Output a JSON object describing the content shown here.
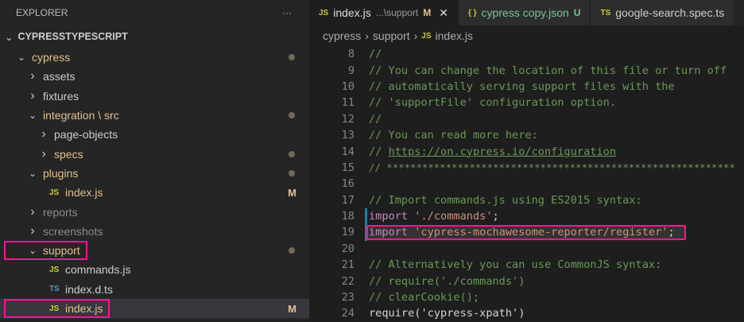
{
  "explorer": {
    "title": "EXPLORER",
    "more": "···",
    "root": "CYPRESSTYPESCRIPT",
    "items": [
      {
        "label": "cypress",
        "type": "folder",
        "open": true,
        "depth": 1,
        "dot": true
      },
      {
        "label": "assets",
        "type": "folder",
        "open": false,
        "depth": 2
      },
      {
        "label": "fixtures",
        "type": "folder",
        "open": false,
        "depth": 2
      },
      {
        "label": "integration \\ src",
        "type": "folder",
        "open": true,
        "depth": 2,
        "dot": true
      },
      {
        "label": "page-objects",
        "type": "folder",
        "open": false,
        "depth": 3
      },
      {
        "label": "specs",
        "type": "folder",
        "open": false,
        "depth": 3,
        "dot": true
      },
      {
        "label": "plugins",
        "type": "folder",
        "open": true,
        "depth": 2,
        "dot": true
      },
      {
        "label": "index.js",
        "type": "js",
        "depth": 3,
        "badge": "M"
      },
      {
        "label": "reports",
        "type": "folder",
        "open": false,
        "depth": 2,
        "dim": true
      },
      {
        "label": "screenshots",
        "type": "folder",
        "open": false,
        "depth": 2,
        "dim": true
      },
      {
        "label": "support",
        "type": "folder",
        "open": true,
        "depth": 2,
        "dot": true,
        "highlight": true
      },
      {
        "label": "commands.js",
        "type": "js",
        "depth": 3
      },
      {
        "label": "index.d.ts",
        "type": "ts",
        "depth": 3
      },
      {
        "label": "index.js",
        "type": "js",
        "depth": 3,
        "badge": "M",
        "selected": true,
        "highlight": true
      }
    ]
  },
  "tabs": [
    {
      "icon": "JS",
      "name": "index.js",
      "path": "...\\support",
      "badge": "M",
      "close": "✕",
      "active": true
    },
    {
      "icon": "{ }",
      "name": "cypress copy.json",
      "badge": "U"
    },
    {
      "icon": "TS",
      "name": "google-search.spec.ts"
    }
  ],
  "breadcrumb": {
    "a": "cypress",
    "b": "support",
    "icon": "JS",
    "c": "index.js"
  },
  "code": [
    {
      "n": "8",
      "t": "//",
      "k": "cm"
    },
    {
      "n": "9",
      "t": "// You can change the location of this file or turn off",
      "k": "cm"
    },
    {
      "n": "10",
      "t": "// automatically serving support files with the",
      "k": "cm"
    },
    {
      "n": "11",
      "t": "// 'supportFile' configuration option.",
      "k": "cm"
    },
    {
      "n": "12",
      "t": "//",
      "k": "cm"
    },
    {
      "n": "13",
      "t": "// You can read more here:",
      "k": "cm"
    },
    {
      "n": "14",
      "a": "// ",
      "t": "https://on.cypress.io/configuration",
      "k": "link"
    },
    {
      "n": "15",
      "t": "// ***********************************************************",
      "k": "cm"
    },
    {
      "n": "16",
      "t": "",
      "k": "pl"
    },
    {
      "n": "17",
      "t": "// Import commands.js using ES2015 syntax:",
      "k": "cm"
    },
    {
      "n": "18",
      "kw": "import",
      "s": "'./commands'",
      "e": ";",
      "k": "imp"
    },
    {
      "n": "19",
      "kw": "import",
      "s": "'cypress-mochawesome-reporter/register'",
      "e": ";",
      "k": "imp",
      "current": true
    },
    {
      "n": "20",
      "t": "",
      "k": "pl"
    },
    {
      "n": "21",
      "t": "// Alternatively you can use CommonJS syntax:",
      "k": "cm"
    },
    {
      "n": "22",
      "t": "// require('./commands')",
      "k": "cm"
    },
    {
      "n": "23",
      "t": "// clearCookie();",
      "k": "cm"
    },
    {
      "n": "24",
      "t": "require('cypress-xpath')",
      "k": "pl"
    }
  ]
}
